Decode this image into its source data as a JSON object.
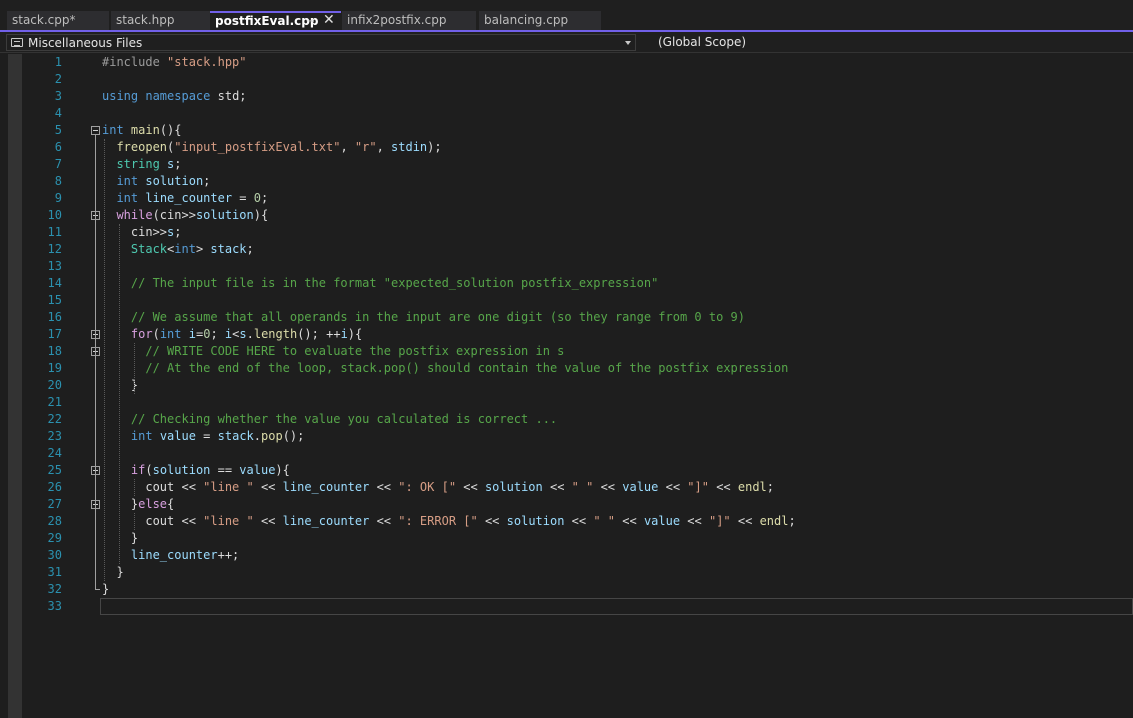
{
  "tabs": [
    {
      "label": "stack.cpp*"
    },
    {
      "label": "stack.hpp"
    },
    {
      "label": "postfixEval.cpp"
    },
    {
      "label": "infix2postfix.cpp"
    },
    {
      "label": "balancing.cpp"
    }
  ],
  "active_tab_pin_glyph": "⊸",
  "active_tab_close_glyph": "✕",
  "nav": {
    "project": "Miscellaneous Files",
    "scope": "(Global Scope)",
    "project_icon": "files-icon",
    "dropdown_icon": "chevron-down-icon"
  },
  "colors": {
    "accent": "#7160e8",
    "line_number": "#2b91af",
    "keyword": "#569cd6",
    "control": "#d8a0df",
    "type": "#4ec9b0",
    "function": "#dcdcaa",
    "variable": "#9cdcfe",
    "string": "#d69d85",
    "number": "#b5cea8",
    "comment": "#57a64a"
  },
  "editor": {
    "current_line": 33,
    "lines": [
      {
        "n": "1",
        "parts": [
          {
            "t": "pp",
            "s": "#include "
          },
          {
            "t": "str",
            "s": "\"stack.hpp\""
          }
        ]
      },
      {
        "n": "2",
        "parts": []
      },
      {
        "n": "3",
        "parts": [
          {
            "t": "kw",
            "s": "using"
          },
          {
            "t": "",
            "s": " "
          },
          {
            "t": "kw",
            "s": "namespace"
          },
          {
            "t": "",
            "s": " std;"
          }
        ]
      },
      {
        "n": "4",
        "parts": []
      },
      {
        "n": "5",
        "parts": [
          {
            "t": "kw",
            "s": "int"
          },
          {
            "t": "",
            "s": " "
          },
          {
            "t": "fn",
            "s": "main"
          },
          {
            "t": "",
            "s": "(){"
          }
        ]
      },
      {
        "n": "6",
        "parts": [
          {
            "t": "",
            "s": "  "
          },
          {
            "t": "fn",
            "s": "freopen"
          },
          {
            "t": "",
            "s": "("
          },
          {
            "t": "str",
            "s": "\"input_postfixEval.txt\""
          },
          {
            "t": "",
            "s": ", "
          },
          {
            "t": "str",
            "s": "\"r\""
          },
          {
            "t": "",
            "s": ", "
          },
          {
            "t": "var",
            "s": "stdin"
          },
          {
            "t": "",
            "s": ");"
          }
        ]
      },
      {
        "n": "7",
        "parts": [
          {
            "t": "",
            "s": "  "
          },
          {
            "t": "typ",
            "s": "string"
          },
          {
            "t": "",
            "s": " "
          },
          {
            "t": "var",
            "s": "s"
          },
          {
            "t": "",
            "s": ";"
          }
        ]
      },
      {
        "n": "8",
        "parts": [
          {
            "t": "",
            "s": "  "
          },
          {
            "t": "kw",
            "s": "int"
          },
          {
            "t": "",
            "s": " "
          },
          {
            "t": "var",
            "s": "solution"
          },
          {
            "t": "",
            "s": ";"
          }
        ]
      },
      {
        "n": "9",
        "parts": [
          {
            "t": "",
            "s": "  "
          },
          {
            "t": "kw",
            "s": "int"
          },
          {
            "t": "",
            "s": " "
          },
          {
            "t": "var",
            "s": "line_counter"
          },
          {
            "t": "",
            "s": " = "
          },
          {
            "t": "num",
            "s": "0"
          },
          {
            "t": "",
            "s": ";"
          }
        ]
      },
      {
        "n": "10",
        "parts": [
          {
            "t": "",
            "s": "  "
          },
          {
            "t": "ctl",
            "s": "while"
          },
          {
            "t": "",
            "s": "(cin>>"
          },
          {
            "t": "var",
            "s": "solution"
          },
          {
            "t": "",
            "s": "){"
          }
        ]
      },
      {
        "n": "11",
        "parts": [
          {
            "t": "",
            "s": "    cin>>"
          },
          {
            "t": "var",
            "s": "s"
          },
          {
            "t": "",
            "s": ";"
          }
        ]
      },
      {
        "n": "12",
        "parts": [
          {
            "t": "",
            "s": "    "
          },
          {
            "t": "typ",
            "s": "Stack"
          },
          {
            "t": "",
            "s": "<"
          },
          {
            "t": "kw",
            "s": "int"
          },
          {
            "t": "",
            "s": "> "
          },
          {
            "t": "var",
            "s": "stack"
          },
          {
            "t": "",
            "s": ";"
          }
        ]
      },
      {
        "n": "13",
        "parts": []
      },
      {
        "n": "14",
        "parts": [
          {
            "t": "",
            "s": "    "
          },
          {
            "t": "cmt",
            "s": "// The input file is in the format \"expected_solution postfix_expression\""
          }
        ]
      },
      {
        "n": "15",
        "parts": []
      },
      {
        "n": "16",
        "parts": [
          {
            "t": "",
            "s": "    "
          },
          {
            "t": "cmt",
            "s": "// We assume that all operands in the input are one digit (so they range from 0 to 9)"
          }
        ]
      },
      {
        "n": "17",
        "parts": [
          {
            "t": "",
            "s": "    "
          },
          {
            "t": "ctl",
            "s": "for"
          },
          {
            "t": "",
            "s": "("
          },
          {
            "t": "kw",
            "s": "int"
          },
          {
            "t": "",
            "s": " "
          },
          {
            "t": "var",
            "s": "i"
          },
          {
            "t": "",
            "s": "="
          },
          {
            "t": "num",
            "s": "0"
          },
          {
            "t": "",
            "s": "; "
          },
          {
            "t": "var",
            "s": "i"
          },
          {
            "t": "",
            "s": "<"
          },
          {
            "t": "var",
            "s": "s"
          },
          {
            "t": "",
            "s": "."
          },
          {
            "t": "fn",
            "s": "length"
          },
          {
            "t": "",
            "s": "(); ++"
          },
          {
            "t": "var",
            "s": "i"
          },
          {
            "t": "",
            "s": "){"
          }
        ]
      },
      {
        "n": "18",
        "parts": [
          {
            "t": "",
            "s": "      "
          },
          {
            "t": "cmt",
            "s": "// WRITE CODE HERE to evaluate the postfix expression in s"
          }
        ]
      },
      {
        "n": "19",
        "parts": [
          {
            "t": "",
            "s": "      "
          },
          {
            "t": "cmt",
            "s": "// At the end of the loop, stack.pop() should contain the value of the postfix expression"
          }
        ]
      },
      {
        "n": "20",
        "parts": [
          {
            "t": "",
            "s": "    }"
          }
        ]
      },
      {
        "n": "21",
        "parts": []
      },
      {
        "n": "22",
        "parts": [
          {
            "t": "",
            "s": "    "
          },
          {
            "t": "cmt",
            "s": "// Checking whether the value you calculated is correct ..."
          }
        ]
      },
      {
        "n": "23",
        "parts": [
          {
            "t": "",
            "s": "    "
          },
          {
            "t": "kw",
            "s": "int"
          },
          {
            "t": "",
            "s": " "
          },
          {
            "t": "var",
            "s": "value"
          },
          {
            "t": "",
            "s": " = "
          },
          {
            "t": "var",
            "s": "stack"
          },
          {
            "t": "",
            "s": "."
          },
          {
            "t": "fn",
            "s": "pop"
          },
          {
            "t": "",
            "s": "();"
          }
        ]
      },
      {
        "n": "24",
        "parts": []
      },
      {
        "n": "25",
        "parts": [
          {
            "t": "",
            "s": "    "
          },
          {
            "t": "ctl",
            "s": "if"
          },
          {
            "t": "",
            "s": "("
          },
          {
            "t": "var",
            "s": "solution"
          },
          {
            "t": "",
            "s": " == "
          },
          {
            "t": "var",
            "s": "value"
          },
          {
            "t": "",
            "s": "){"
          }
        ]
      },
      {
        "n": "26",
        "parts": [
          {
            "t": "",
            "s": "      cout << "
          },
          {
            "t": "str",
            "s": "\"line \""
          },
          {
            "t": "",
            "s": " << "
          },
          {
            "t": "var",
            "s": "line_counter"
          },
          {
            "t": "",
            "s": " << "
          },
          {
            "t": "str",
            "s": "\": OK [\""
          },
          {
            "t": "",
            "s": " << "
          },
          {
            "t": "var",
            "s": "solution"
          },
          {
            "t": "",
            "s": " << "
          },
          {
            "t": "str",
            "s": "\" \""
          },
          {
            "t": "",
            "s": " << "
          },
          {
            "t": "var",
            "s": "value"
          },
          {
            "t": "",
            "s": " << "
          },
          {
            "t": "str",
            "s": "\"]\""
          },
          {
            "t": "",
            "s": " << "
          },
          {
            "t": "fn",
            "s": "endl"
          },
          {
            "t": "",
            "s": ";"
          }
        ]
      },
      {
        "n": "27",
        "parts": [
          {
            "t": "",
            "s": "    }"
          },
          {
            "t": "ctl",
            "s": "else"
          },
          {
            "t": "",
            "s": "{"
          }
        ]
      },
      {
        "n": "28",
        "parts": [
          {
            "t": "",
            "s": "      cout << "
          },
          {
            "t": "str",
            "s": "\"line \""
          },
          {
            "t": "",
            "s": " << "
          },
          {
            "t": "var",
            "s": "line_counter"
          },
          {
            "t": "",
            "s": " << "
          },
          {
            "t": "str",
            "s": "\": ERROR [\""
          },
          {
            "t": "",
            "s": " << "
          },
          {
            "t": "var",
            "s": "solution"
          },
          {
            "t": "",
            "s": " << "
          },
          {
            "t": "str",
            "s": "\" \""
          },
          {
            "t": "",
            "s": " << "
          },
          {
            "t": "var",
            "s": "value"
          },
          {
            "t": "",
            "s": " << "
          },
          {
            "t": "str",
            "s": "\"]\""
          },
          {
            "t": "",
            "s": " << "
          },
          {
            "t": "fn",
            "s": "endl"
          },
          {
            "t": "",
            "s": ";"
          }
        ]
      },
      {
        "n": "29",
        "parts": [
          {
            "t": "",
            "s": "    }"
          }
        ]
      },
      {
        "n": "30",
        "parts": [
          {
            "t": "",
            "s": "    "
          },
          {
            "t": "var",
            "s": "line_counter"
          },
          {
            "t": "",
            "s": "++;"
          }
        ]
      },
      {
        "n": "31",
        "parts": [
          {
            "t": "",
            "s": "  }"
          }
        ]
      },
      {
        "n": "32",
        "parts": [
          {
            "t": "",
            "s": "}"
          }
        ]
      },
      {
        "n": "33",
        "parts": []
      }
    ]
  }
}
